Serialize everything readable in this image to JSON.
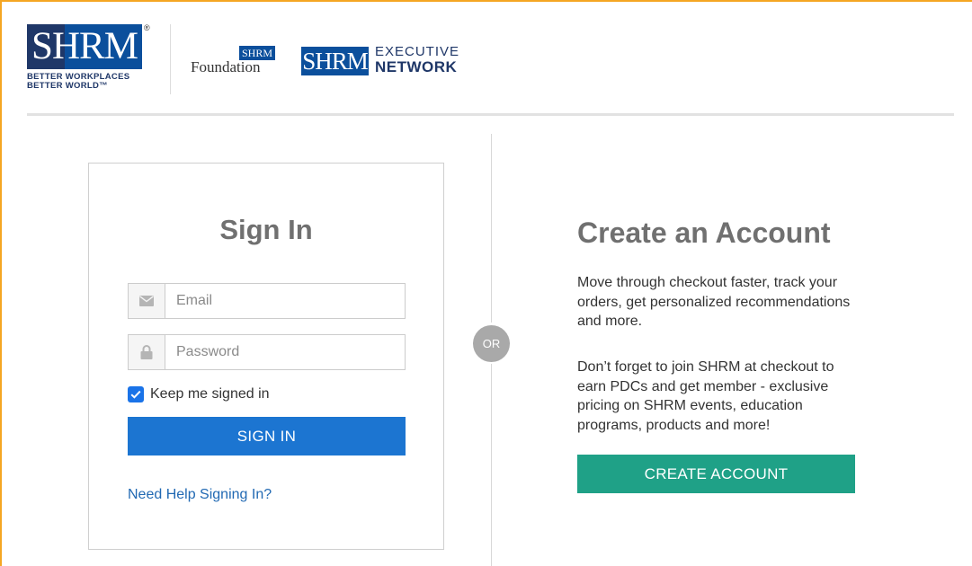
{
  "header": {
    "shrm_logo": {
      "text": "SHRM",
      "registered": "®",
      "tagline_line1": "BETTER WORKPLACES",
      "tagline_line2": "BETTER WORLD™"
    },
    "foundation_logo": {
      "mini": "SHRM",
      "text": "Foundation"
    },
    "executive_logo": {
      "box": "SHRM",
      "top": "EXECUTIVE",
      "bottom": "NETWORK"
    }
  },
  "signin": {
    "title": "Sign In",
    "email_placeholder": "Email",
    "password_placeholder": "Password",
    "keep_signed_in_label": "Keep me signed in",
    "keep_signed_in_checked": true,
    "button_label": "SIGN IN",
    "help_link": "Need Help Signing In?"
  },
  "divider": {
    "label": "OR"
  },
  "create": {
    "title": "Create an Account",
    "description": "Move through checkout faster, track your orders, get personalized recommendations and more.",
    "description2": "Don’t forget to join SHRM at checkout to earn PDCs and get member - exclusive pricing on SHRM events, education programs, products and more!",
    "button_label": "CREATE ACCOUNT"
  },
  "colors": {
    "brand_blue": "#0b4f9c",
    "brand_navy": "#1f3768",
    "signin_button": "#1c75d1",
    "create_button": "#1fa187",
    "link": "#2169b3",
    "frame_accent": "#f5a623"
  },
  "icons": {
    "email": "envelope-icon",
    "password": "lock-icon",
    "checkbox": "check-icon"
  }
}
